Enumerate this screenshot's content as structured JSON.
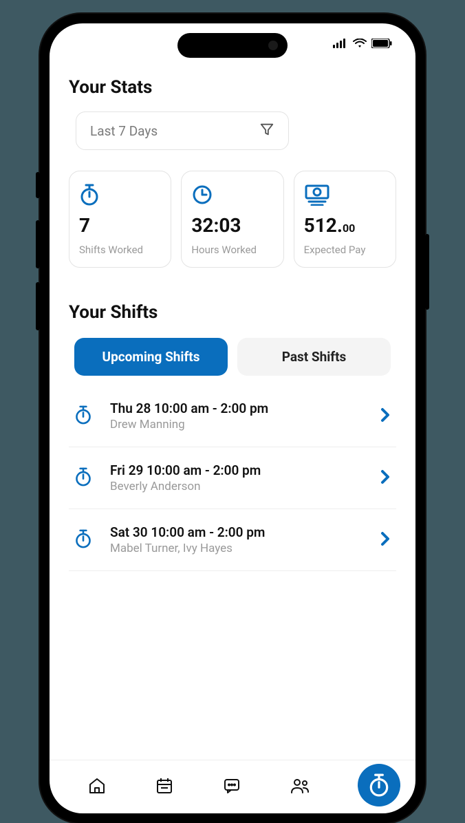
{
  "stats": {
    "title": "Your Stats",
    "filter_label": "Last 7 Days",
    "cards": [
      {
        "value": "7",
        "label": "Shifts Worked"
      },
      {
        "value": "32:03",
        "label": "Hours Worked"
      },
      {
        "value_main": "512.",
        "value_cents": "00",
        "label": "Expected Pay"
      }
    ]
  },
  "shifts": {
    "title": "Your Shifts",
    "tabs": {
      "upcoming": "Upcoming Shifts",
      "past": "Past Shifts"
    },
    "items": [
      {
        "title": "Thu 28  10:00 am - 2:00 pm",
        "sub": "Drew Manning"
      },
      {
        "title": "Fri 29  10:00 am - 2:00 pm",
        "sub": "Beverly Anderson"
      },
      {
        "title": "Sat 30  10:00 am - 2:00 pm",
        "sub": "Mabel Turner, Ivy Hayes"
      }
    ]
  },
  "colors": {
    "accent": "#0a6ebd"
  }
}
